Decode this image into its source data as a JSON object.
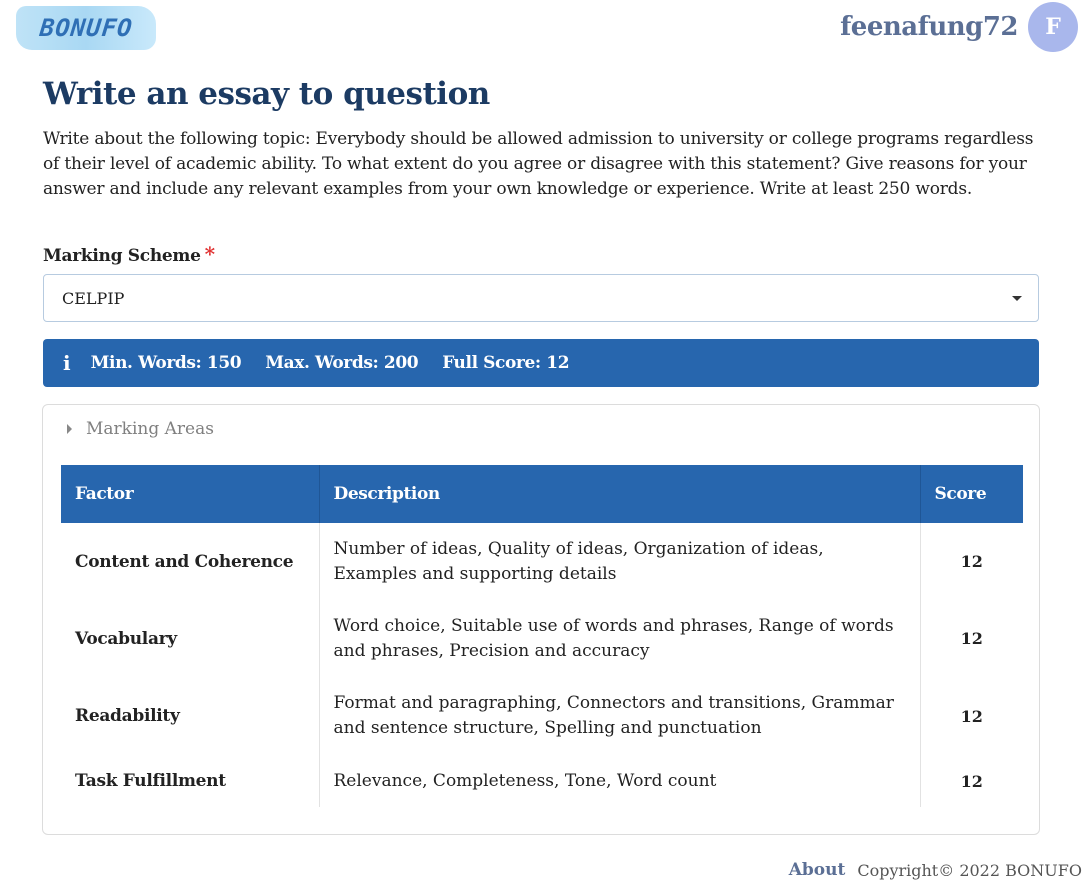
{
  "header": {
    "logo_text": "BONUFO",
    "username": "feenafung72",
    "avatar_initial": "F"
  },
  "page": {
    "title": "Write an essay to question",
    "prompt": "Write about the following topic: Everybody should be allowed admission to university or college programs regardless of their level of academic ability. To what extent do you agree or disagree with this statement? Give reasons for your answer and include any relevant examples from your own knowledge or experience. Write at least 250 words."
  },
  "form": {
    "marking_scheme_label": "Marking Scheme",
    "required_mark": "*",
    "marking_scheme_value": "CELPIP"
  },
  "info": {
    "icon": "i",
    "min_words": "Min. Words: 150",
    "max_words": "Max. Words: 200",
    "full_score": "Full Score: 12"
  },
  "marking_areas": {
    "toggle_label": "Marking Areas",
    "headers": {
      "factor": "Factor",
      "description": "Description",
      "score": "Score"
    },
    "rows": [
      {
        "factor": "Content and Coherence",
        "description": "Number of ideas, Quality of ideas, Organization of ideas, Examples and supporting details",
        "score": "12"
      },
      {
        "factor": "Vocabulary",
        "description": "Word choice, Suitable use of words and phrases, Range of words and phrases, Precision and accuracy",
        "score": "12"
      },
      {
        "factor": "Readability",
        "description": "Format and paragraphing, Connectors and transitions, Grammar and sentence structure, Spelling and punctuation",
        "score": "12"
      },
      {
        "factor": "Task Fulfillment",
        "description": "Relevance, Completeness, Tone, Word count",
        "score": "12"
      }
    ]
  },
  "footer": {
    "about": "About",
    "copyright": "Copyright© 2022 BONUFO"
  },
  "colors": {
    "primary": "#2766ae",
    "title": "#1c3b63",
    "username": "#5b6f95",
    "avatar": "#a9b7ec",
    "required": "#e03131"
  }
}
